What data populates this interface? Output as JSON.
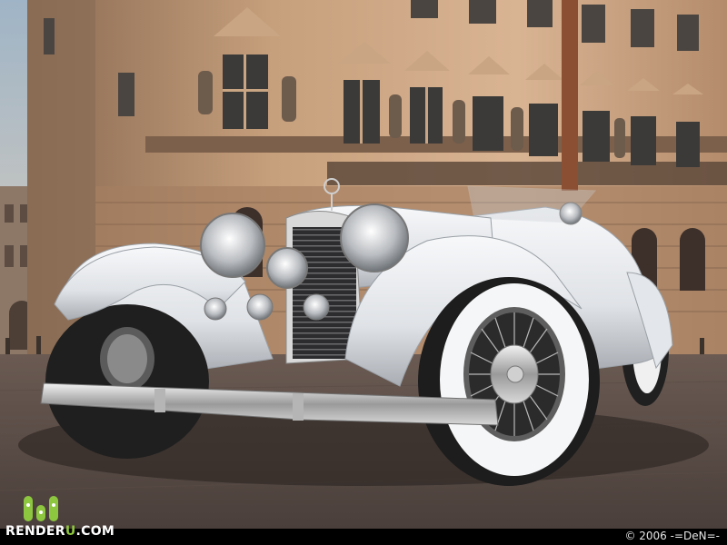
{
  "logo": {
    "brand_prefix": "RENDER",
    "brand_accent": "U",
    "brand_suffix": ".COM",
    "accent_color": "#8dc63f"
  },
  "footer": {
    "copyright": "© 2006 -=DeN=-"
  },
  "colors": {
    "sky": "#aebfcc",
    "building": "#b98f6e",
    "car_body": "#e9ebee",
    "pavement": "#6e5f57"
  }
}
